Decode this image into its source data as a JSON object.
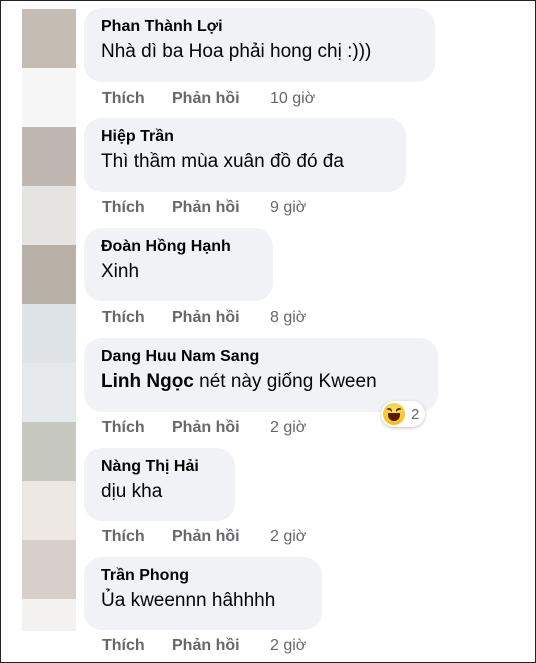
{
  "comments": [
    {
      "author": "Phan Thành Lợi",
      "text": "Nhà dì ba Hoa phải hong chị :)))",
      "like": "Thích",
      "reply": "Phản hồi",
      "time": "10 giờ",
      "avatar_top": "#c3bdb3",
      "avatar_bottom": "#f6f6f6"
    },
    {
      "author": "Hiệp Trần",
      "text": "Thì thầm mùa xuân đồ đó đa",
      "like": "Thích",
      "reply": "Phản hồi",
      "time": "9 giờ",
      "avatar_top": "#c0b8b0",
      "avatar_bottom": "#e6e4e1"
    },
    {
      "author": "Đoàn Hồng Hạnh",
      "text": "Xinh",
      "like": "Thích",
      "reply": "Phản hồi",
      "time": "8 giờ",
      "avatar_top": "#b8b0a6",
      "avatar_bottom": "#dde3e6"
    },
    {
      "author": "Dang Huu Nam Sang",
      "mention": "Linh Ngọc",
      "text": " nét này giống Kween",
      "like": "Thích",
      "reply": "Phản hồi",
      "time": "2 giờ",
      "avatar_top": "#dfe4e8",
      "avatar_bottom": "#c6c7bf",
      "reaction_count": "2",
      "reaction_icon": "haha-reaction-icon"
    },
    {
      "author": "Nàng Thị Hải",
      "text": "dịu kha",
      "like": "Thích",
      "reply": "Phản hồi",
      "time": "2 giờ",
      "avatar_top": "#cfd0c8",
      "avatar_bottom": "#ece7e2"
    },
    {
      "author": "Trần Phong",
      "text": "Ủa kweennn hâhhhh",
      "like": "Thích",
      "reply": "Phản hồi",
      "time": "2 giờ",
      "avatar_top": "#d6cfcb",
      "avatar_bottom": "#f4f1f1"
    }
  ]
}
